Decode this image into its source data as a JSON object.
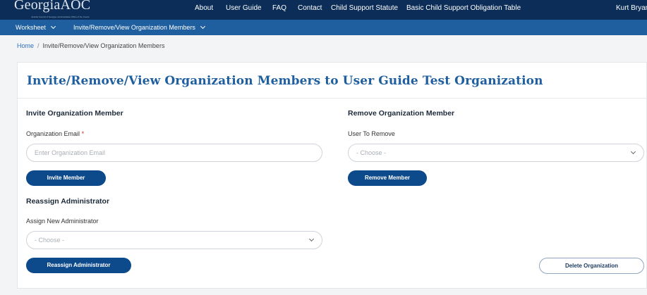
{
  "header": {
    "logo_text": "GeorgiaAOC",
    "logo_subtext": "Judicial Council of Georgia, Administrative Office of the Courts",
    "nav": [
      "About",
      "User Guide",
      "FAQ",
      "Contact",
      "Child Support Statute",
      "Basic Child Support Obligation Table"
    ],
    "user_name": "Kurt Bryan"
  },
  "subnav": {
    "worksheet": "Worksheet",
    "members": "Invite/Remove/View Organization Members"
  },
  "breadcrumb": {
    "home": "Home",
    "separator": "/",
    "current": "Invite/Remove/View Organization Members"
  },
  "page": {
    "title": "Invite/Remove/View Organization Members to User Guide Test Organization"
  },
  "invite": {
    "heading": "Invite Organization Member",
    "email_label": "Organization Email",
    "required_mark": "*",
    "email_placeholder": "Enter Organization Email",
    "button": "Invite Member"
  },
  "remove": {
    "heading": "Remove Organization Member",
    "user_label": "User To Remove",
    "select_value": "- Choose -",
    "button": "Remove Member"
  },
  "reassign": {
    "heading": "Reassign Administrator",
    "admin_label": "Assign New Administrator",
    "select_value": "- Choose -",
    "button": "Reassign Administrator"
  },
  "delete": {
    "button": "Delete Organization"
  },
  "colors": {
    "header_bg": "#0b2d57",
    "subnav_bg": "#1f5f9f",
    "primary_button": "#0d4a8c",
    "title": "#1f5f9f",
    "required": "#d42a2a"
  }
}
